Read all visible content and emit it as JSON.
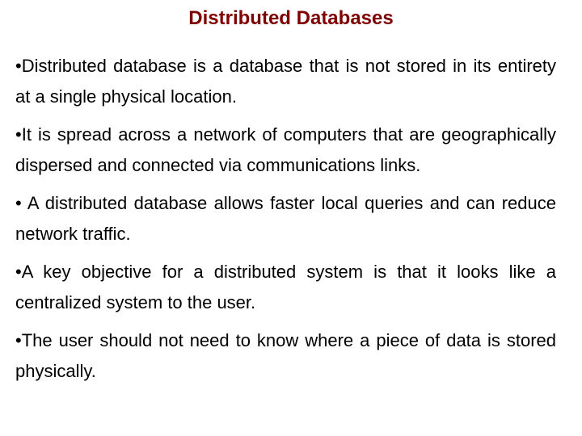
{
  "slide": {
    "title": "Distributed Databases",
    "title_color": "#7f0000",
    "bullets": [
      "•Distributed database is a database that is not stored in its entirety at a single physical location.",
      "•It is spread across a network of computers that are geographically dispersed and connected via communications links.",
      "• A distributed database allows faster local queries and can reduce network traffic.",
      "•A key objective for a distributed system is that it looks like a centralized system to the user.",
      "•The user should not need to know where a piece of data is stored physically."
    ]
  }
}
